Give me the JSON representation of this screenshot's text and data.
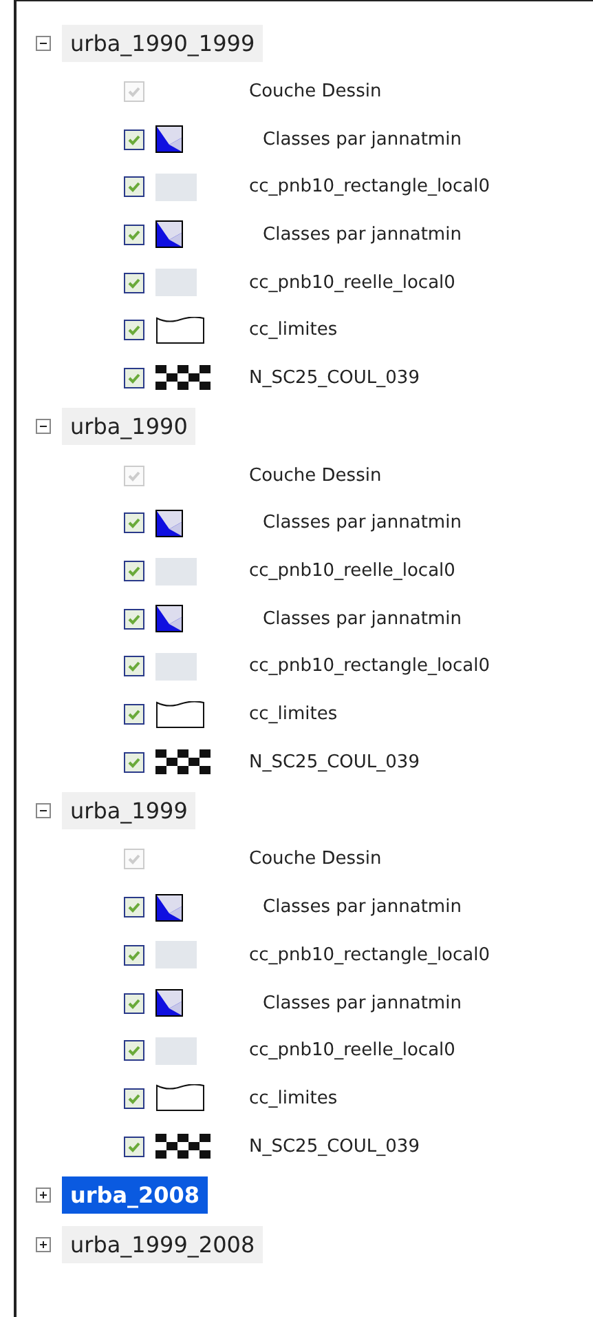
{
  "groups": [
    {
      "name": "urba_1990_1999",
      "expanded": true,
      "selected": false,
      "layers": [
        {
          "name": "Couche Dessin",
          "kind": "none",
          "checked": true,
          "disabled": true
        },
        {
          "name": "Classes par jannatmin",
          "kind": "classes",
          "checked": true,
          "disabled": false
        },
        {
          "name": "cc_pnb10_rectangle_local0",
          "kind": "fill",
          "checked": true,
          "disabled": false
        },
        {
          "name": "Classes par jannatmin",
          "kind": "classes",
          "checked": true,
          "disabled": false
        },
        {
          "name": "cc_pnb10_reelle_local0",
          "kind": "fill",
          "checked": true,
          "disabled": false
        },
        {
          "name": "cc_limites",
          "kind": "outline",
          "checked": true,
          "disabled": false
        },
        {
          "name": "N_SC25_COUL_039",
          "kind": "raster",
          "checked": true,
          "disabled": false
        }
      ]
    },
    {
      "name": "urba_1990",
      "expanded": true,
      "selected": false,
      "layers": [
        {
          "name": "Couche Dessin",
          "kind": "none",
          "checked": true,
          "disabled": true
        },
        {
          "name": "Classes par jannatmin",
          "kind": "classes",
          "checked": true,
          "disabled": false
        },
        {
          "name": "cc_pnb10_reelle_local0",
          "kind": "fill",
          "checked": true,
          "disabled": false
        },
        {
          "name": "Classes par jannatmin",
          "kind": "classes",
          "checked": true,
          "disabled": false
        },
        {
          "name": "cc_pnb10_rectangle_local0",
          "kind": "fill",
          "checked": true,
          "disabled": false
        },
        {
          "name": "cc_limites",
          "kind": "outline",
          "checked": true,
          "disabled": false
        },
        {
          "name": "N_SC25_COUL_039",
          "kind": "raster",
          "checked": true,
          "disabled": false
        }
      ]
    },
    {
      "name": "urba_1999",
      "expanded": true,
      "selected": false,
      "layers": [
        {
          "name": "Couche Dessin",
          "kind": "none",
          "checked": true,
          "disabled": true
        },
        {
          "name": "Classes par jannatmin",
          "kind": "classes",
          "checked": true,
          "disabled": false
        },
        {
          "name": "cc_pnb10_rectangle_local0",
          "kind": "fill",
          "checked": true,
          "disabled": false
        },
        {
          "name": "Classes par jannatmin",
          "kind": "classes",
          "checked": true,
          "disabled": false
        },
        {
          "name": "cc_pnb10_reelle_local0",
          "kind": "fill",
          "checked": true,
          "disabled": false
        },
        {
          "name": "cc_limites",
          "kind": "outline",
          "checked": true,
          "disabled": false
        },
        {
          "name": "N_SC25_COUL_039",
          "kind": "raster",
          "checked": true,
          "disabled": false
        }
      ]
    },
    {
      "name": "urba_2008",
      "expanded": false,
      "selected": true
    },
    {
      "name": "urba_1999_2008",
      "expanded": false,
      "selected": false
    }
  ]
}
